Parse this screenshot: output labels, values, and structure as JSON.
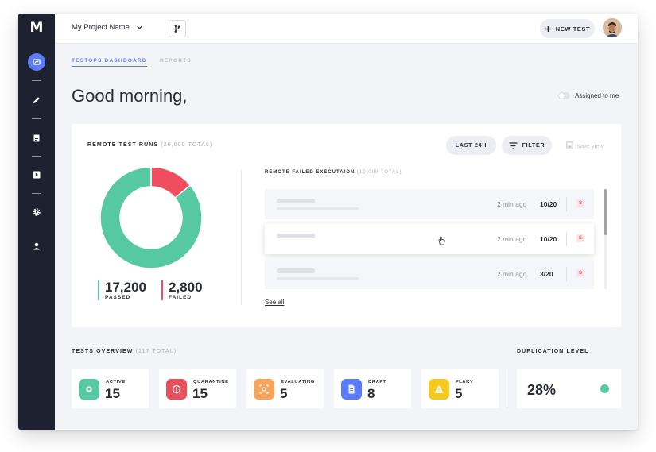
{
  "app": {
    "logo": "M"
  },
  "sidebar": {
    "items": [
      {
        "name": "dashboard",
        "icon": "chart-icon",
        "active": true
      },
      {
        "name": "edit",
        "icon": "pencil-icon"
      },
      {
        "name": "list",
        "icon": "document-icon"
      },
      {
        "name": "runs",
        "icon": "play-icon"
      },
      {
        "name": "settings",
        "icon": "gear-icon"
      },
      {
        "name": "profile",
        "icon": "user-icon"
      }
    ]
  },
  "topbar": {
    "project_name": "My Project Name",
    "new_test_label": "NEW TEST"
  },
  "tabs": [
    {
      "label": "TESTOPS DASHBOARD",
      "active": true
    },
    {
      "label": "REPORTS",
      "active": false
    }
  ],
  "greeting": "Good morning,",
  "assigned_to_me": {
    "label": "Assigned to me",
    "on": false
  },
  "remote_runs": {
    "title": "REMOTE TEST RUNS",
    "total": "(20,000 TOTAL)",
    "last_label": "LAST 24H",
    "filter_label": "FILTER",
    "save_view_label": "save view",
    "passed": {
      "value": "17,200",
      "label": "PASSED"
    },
    "failed": {
      "value": "2,800",
      "label": "FAILED"
    }
  },
  "chart_data": {
    "type": "pie",
    "categories": [
      "Passed",
      "Failed"
    ],
    "values": [
      17200,
      2800
    ],
    "colors": [
      "#56c9a3",
      "#ef4e5f"
    ]
  },
  "failed_executions": {
    "title": "REMOTE FAILED EXECUTAION",
    "total": "(10,000 TOTAL)",
    "rows": [
      {
        "time": "2 min ago",
        "score": "10/20",
        "badge": "S"
      },
      {
        "time": "2 min ago",
        "score": "10/20",
        "badge": "S"
      },
      {
        "time": "2 min ago",
        "score": "3/20",
        "badge": "S"
      }
    ],
    "see_all": "See all"
  },
  "tests_overview": {
    "title": "TESTS OVERVIEW",
    "total": "(117 TOTAL)",
    "tiles": [
      {
        "label": "ACTIVE",
        "value": "15",
        "color": "#56c9a3",
        "icon": "active-icon"
      },
      {
        "label": "QUARANTINE",
        "value": "15",
        "color": "#e8505b",
        "icon": "alert-icon"
      },
      {
        "label": "EVALUATING",
        "value": "5",
        "color": "#f8a35c",
        "icon": "evaluate-icon"
      },
      {
        "label": "DRAFT",
        "value": "8",
        "color": "#5b7cfa",
        "icon": "draft-icon"
      },
      {
        "label": "FLAKY",
        "value": "5",
        "color": "#f4c91d",
        "icon": "warning-icon"
      }
    ]
  },
  "duplication": {
    "title": "DUPLICATION LEVEL",
    "value": "28%",
    "color": "#56c9a3"
  }
}
